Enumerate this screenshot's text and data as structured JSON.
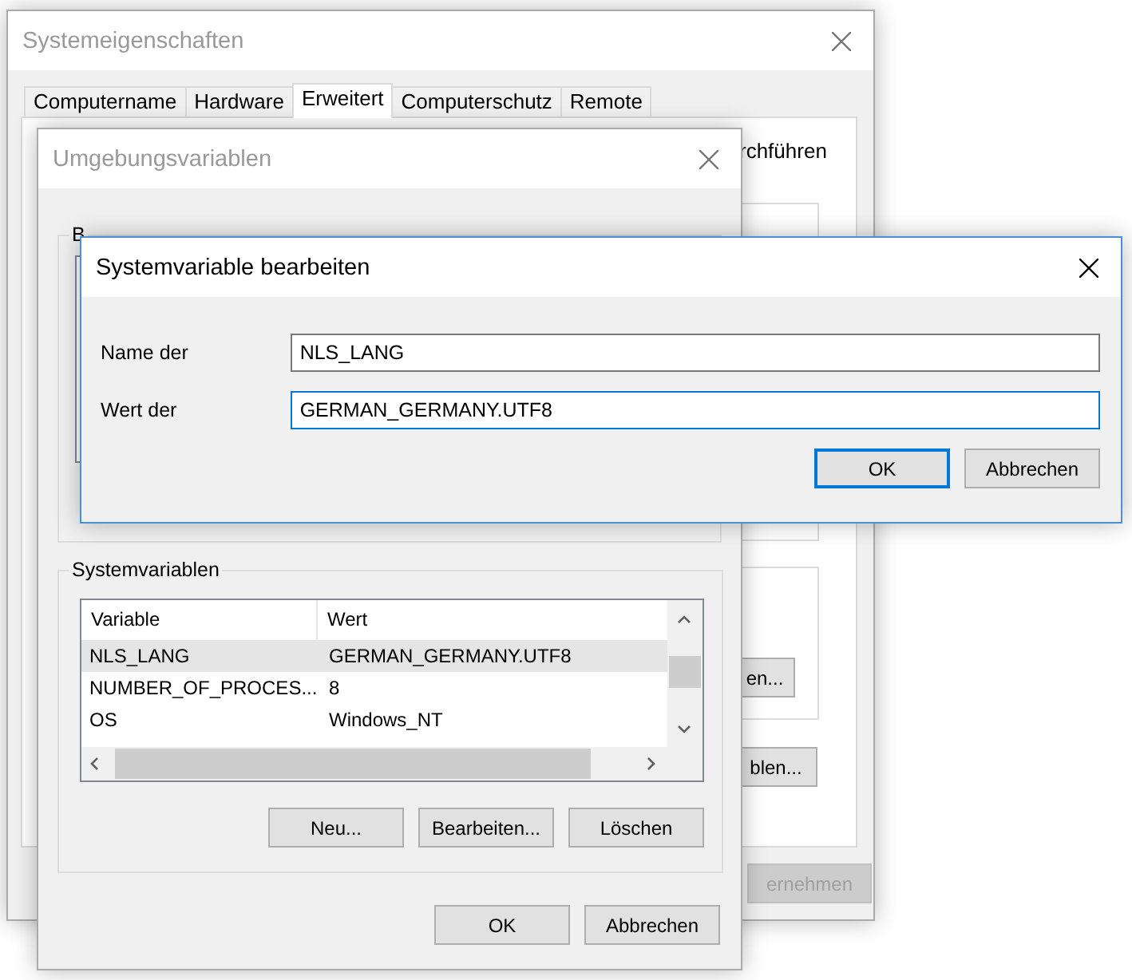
{
  "system_properties": {
    "title": "Systemeigenschaften",
    "active": false,
    "tabs": [
      {
        "label": "Computername",
        "selected": false
      },
      {
        "label": "Hardware",
        "selected": false
      },
      {
        "label": "Erweitert",
        "selected": true
      },
      {
        "label": "Computerschutz",
        "selected": false
      },
      {
        "label": "Remote",
        "selected": false
      }
    ],
    "panel_text": "rchführen",
    "buttons": [
      {
        "label": "en...",
        "disabled": false
      },
      {
        "label": "blen...",
        "disabled": false
      },
      {
        "label": "ernehmen",
        "disabled": true
      }
    ]
  },
  "environment_variables": {
    "title": "Umgebungsvariablen",
    "active": false,
    "user_variables": {
      "title": "B"
    },
    "system_variables": {
      "title": "Systemvariablen",
      "columns": [
        "Variable",
        "Wert"
      ],
      "rows": [
        {
          "variable": "NLS_LANG",
          "value": "GERMAN_GERMANY.UTF8",
          "selected": true
        },
        {
          "variable": "NUMBER_OF_PROCES...",
          "value": "8",
          "selected": false
        },
        {
          "variable": "OS",
          "value": "Windows_NT",
          "selected": false
        }
      ],
      "buttons": [
        "Neu...",
        "Bearbeiten...",
        "Löschen"
      ]
    },
    "buttons": [
      "OK",
      "Abbrechen"
    ]
  },
  "edit_dialog": {
    "title": "Systemvariable bearbeiten",
    "active": true,
    "fields": [
      {
        "label": "Name der",
        "value": "NLS_LANG",
        "focused": false
      },
      {
        "label": "Wert der",
        "value": "GERMAN_GERMANY.UTF8",
        "focused": true
      }
    ],
    "buttons": [
      {
        "label": "OK",
        "default": true
      },
      {
        "label": "Abbrechen",
        "default": false
      }
    ]
  }
}
